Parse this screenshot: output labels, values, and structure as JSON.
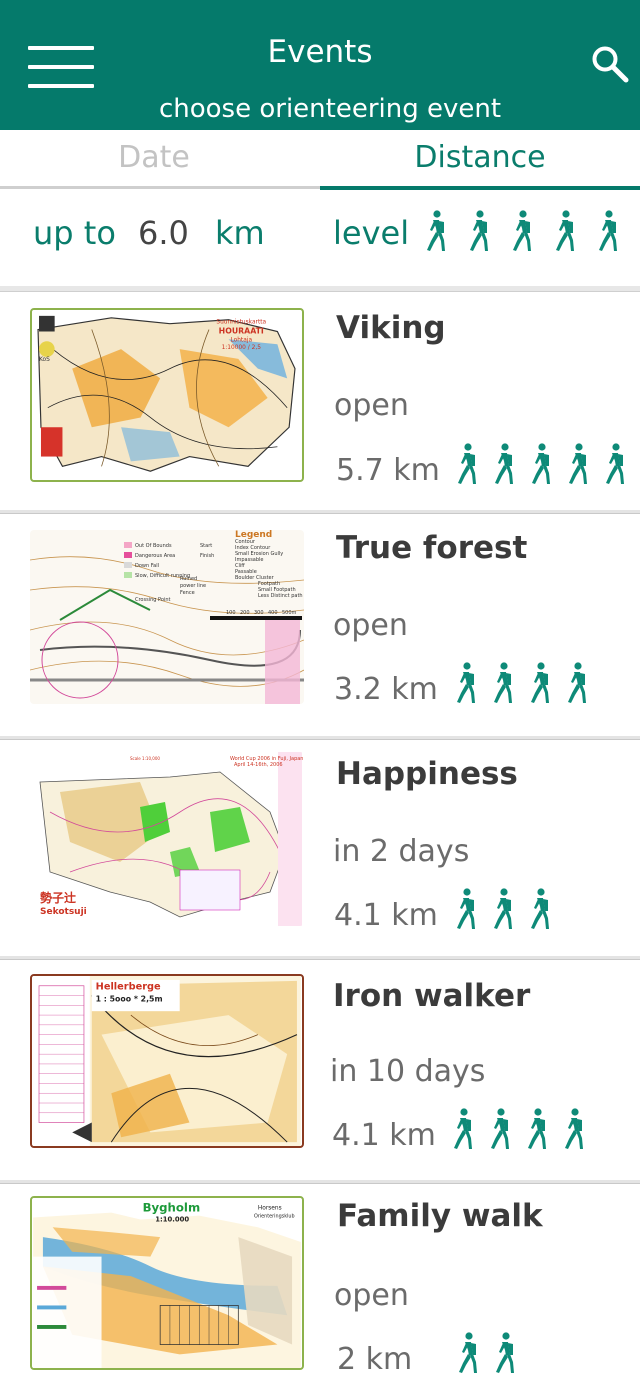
{
  "header": {
    "title": "Events",
    "subtitle": "choose orienteering event",
    "menu_icon": "hamburger-icon",
    "search_icon": "search-icon",
    "background_color": "#057a6b"
  },
  "tabs": [
    {
      "label": "Date",
      "selected": false
    },
    {
      "label": "Distance",
      "selected": true
    }
  ],
  "filter": {
    "prefix": "up to",
    "distance_value": "6.0",
    "unit": "km",
    "level_label": "level",
    "level": 5,
    "walker_icon": "hiker-icon"
  },
  "colors": {
    "accent": "#057a6b",
    "walker": "#0e8a78"
  },
  "events": [
    {
      "name": "Viking",
      "status": "open",
      "distance": "5.7 km",
      "level": 5,
      "map_icon": "orienteering-map-thumbnail"
    },
    {
      "name": "True forest",
      "status": "open",
      "distance": "3.2 km",
      "level": 4,
      "map_icon": "orienteering-map-thumbnail"
    },
    {
      "name": "Happiness",
      "status": "in 2 days",
      "distance": "4.1 km",
      "level": 3,
      "map_icon": "orienteering-map-thumbnail"
    },
    {
      "name": "Iron walker",
      "status": "in 10 days",
      "distance": "4.1 km",
      "level": 4,
      "map_icon": "orienteering-map-thumbnail"
    },
    {
      "name": "Family walk",
      "status": "open",
      "distance": "2 km",
      "level": 2,
      "map_icon": "orienteering-map-thumbnail"
    }
  ],
  "map_labels": {
    "viking": [
      "Suunnistuskartta",
      "HOURAATI",
      "Lohtaja",
      "1:10000 / 2,5",
      "KoS"
    ],
    "true_forest": [
      "Legend",
      "Out Of Bounds",
      "Dangerous Area",
      "Down Fall",
      "Slow, Difficult running",
      "power line",
      "Fence",
      "Crossing Point",
      "Start",
      "Finish",
      "Contour",
      "Index Contour",
      "Small Erosion Gully",
      "Impassable",
      "Cliff",
      "Passable",
      "Ruined",
      "Boulder Cluster",
      "Footpath",
      "Small Footpath",
      "Less Distinct path",
      "100",
      "200",
      "300",
      "400",
      "500m"
    ],
    "happiness": [
      "World Cup 2006 in Fuji, Japan",
      "April 14-16th, 2006",
      "Scale 1:10,000",
      "勢子辻",
      "Sekotsuji"
    ],
    "iron_walker": [
      "Hellerberge",
      "1 : 5ooo * 2,5m"
    ],
    "family_walk": [
      "Bygholm",
      "1:10.000",
      "Horsens",
      "Orienteringsklub"
    ]
  }
}
